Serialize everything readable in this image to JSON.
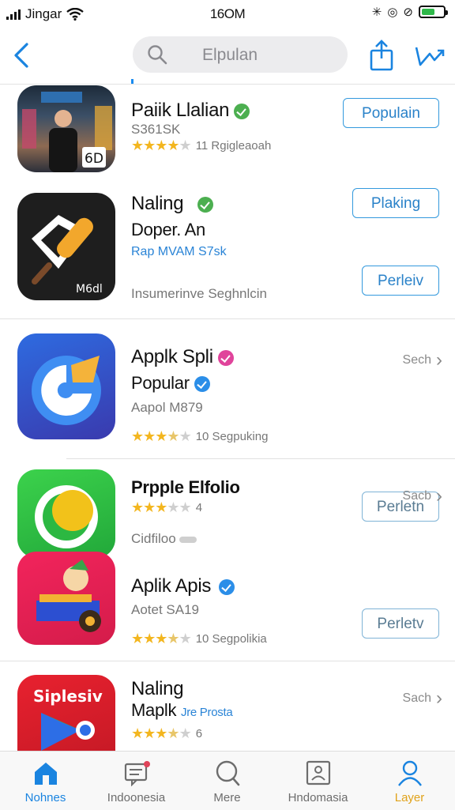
{
  "status_bar": {
    "carrier": "Jingar",
    "time": "16OM"
  },
  "nav": {
    "search_text": "Elpulan"
  },
  "apps": [
    {
      "name": "Paiik Llalian",
      "badge_color": "#4caf50",
      "subtitle": "S361SK",
      "stars": 4,
      "rating_text": "11 Rgigleaoah",
      "button": "Populain"
    },
    {
      "name": "Naling",
      "badge_color": "#4caf50",
      "subtitle": "Doper. An",
      "link": "Rap MVAM S7sk",
      "meta": "Insumerinve  Seghnlcin",
      "icon_text": "M6dl",
      "button": "Plaking",
      "button2": "Perleiv"
    },
    {
      "name": "Applk Spli",
      "badge_color": "#e0449b",
      "subtitle": "Popular",
      "subtitle_badge_color": "#2b8ee8",
      "meta": "Aapol M879",
      "stars": 3.5,
      "rating_text": "10  Segpuking",
      "side_link": "Sech",
      "button": "Perletn"
    },
    {
      "name": "Prpple Elfolio",
      "stars": 3,
      "rating_text": "4",
      "meta": "Cidfiloo",
      "side_link": "Sacb"
    },
    {
      "name": "Aplik Apis",
      "badge_color": "#2b8ee8",
      "meta": "Aotet SA19",
      "stars": 3.5,
      "rating_text": "10  Segpolikia",
      "button": "Perletv"
    },
    {
      "name": "Naling",
      "subtitle": "Maplk",
      "link": "Jre Prosta",
      "icon_text": "Siplesiv",
      "stars": 3.5,
      "rating_text": "6",
      "side_link": "Sach"
    }
  ],
  "tabs": [
    {
      "label": "Nohnes",
      "icon": "house-icon"
    },
    {
      "label": "Indoonesia",
      "icon": "inbox-icon"
    },
    {
      "label": "Mere",
      "icon": "search-icon"
    },
    {
      "label": "Hndomasia",
      "icon": "portrait-icon"
    },
    {
      "label": "Layer",
      "icon": "person-icon"
    }
  ],
  "colors": {
    "accent": "#1a84e0",
    "star": "#f3b61f",
    "battery": "#2fb84a"
  }
}
